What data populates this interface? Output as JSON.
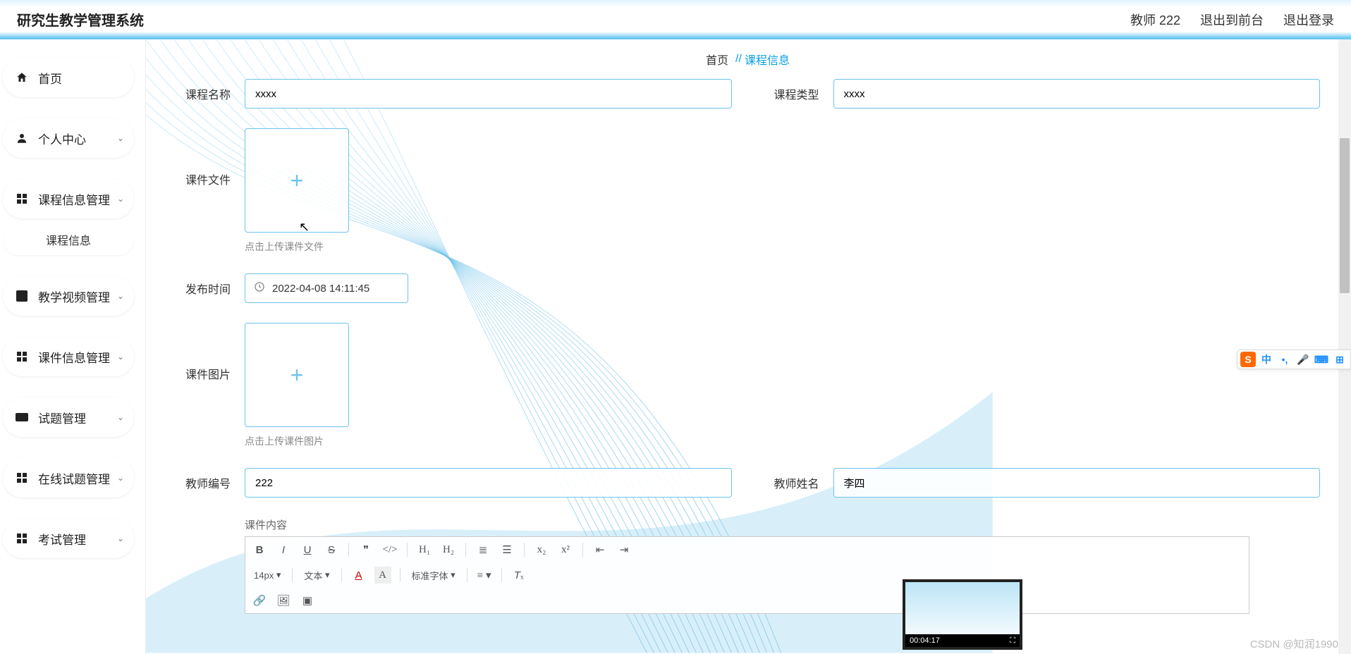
{
  "header": {
    "title": "研究生教学管理系统",
    "user_label": "教师 222",
    "exit_front": "退出到前台",
    "logout": "退出登录"
  },
  "sidebar": {
    "items": [
      {
        "icon": "home",
        "label": "首页",
        "expandable": false
      },
      {
        "icon": "user",
        "label": "个人中心",
        "expandable": true
      },
      {
        "icon": "grid",
        "label": "课程信息管理",
        "expandable": true
      },
      {
        "icon": "chart",
        "label": "教学视频管理",
        "expandable": true
      },
      {
        "icon": "grid",
        "label": "课件信息管理",
        "expandable": true
      },
      {
        "icon": "dots",
        "label": "试题管理",
        "expandable": true
      },
      {
        "icon": "grid",
        "label": "在线试题管理",
        "expandable": true
      },
      {
        "icon": "grid",
        "label": "考试管理",
        "expandable": true
      }
    ],
    "sub_item": "课程信息"
  },
  "breadcrumb": {
    "home": "首页",
    "sep": "//",
    "current": "课程信息"
  },
  "form": {
    "course_name_label": "课程名称",
    "course_name_value": "xxxx",
    "course_type_label": "课程类型",
    "course_type_value": "xxxx",
    "courseware_file_label": "课件文件",
    "courseware_file_hint": "点击上传课件文件",
    "publish_time_label": "发布时间",
    "publish_time_value": "2022-04-08 14:11:45",
    "courseware_img_label": "课件图片",
    "courseware_img_hint": "点击上传课件图片",
    "teacher_no_label": "教师编号",
    "teacher_no_value": "222",
    "teacher_name_label": "教师姓名",
    "teacher_name_value": "李四",
    "courseware_content_label": "课件内容"
  },
  "editor": {
    "font_size": "14px",
    "text_label": "文本",
    "font_family_label": "标准字体"
  },
  "video_thumb": {
    "time": "00:04:17"
  },
  "watermark": "CSDN @知润1990",
  "ime": {
    "zhong": "中"
  }
}
